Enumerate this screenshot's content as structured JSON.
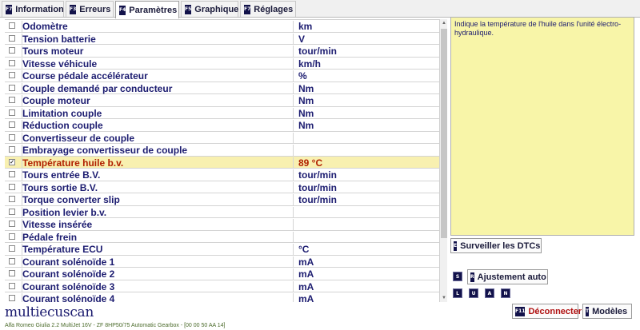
{
  "tabs": [
    {
      "key": "F7",
      "label": "Information"
    },
    {
      "key": "F3",
      "label": "Erreurs"
    },
    {
      "key": "F4",
      "label": "Paramètres"
    },
    {
      "key": "F5",
      "label": "Graphique"
    },
    {
      "key": "F7",
      "label": "Réglages"
    }
  ],
  "parameters": [
    {
      "name": "Odomètre",
      "value": "km",
      "checked": false
    },
    {
      "name": "Tension batterie",
      "value": "V",
      "checked": false
    },
    {
      "name": "Tours moteur",
      "value": "tour/min",
      "checked": false
    },
    {
      "name": "Vitesse véhicule",
      "value": "km/h",
      "checked": false
    },
    {
      "name": "Course pédale accélérateur",
      "value": "%",
      "checked": false
    },
    {
      "name": "Couple demandé par conducteur",
      "value": "Nm",
      "checked": false
    },
    {
      "name": "Couple moteur",
      "value": "Nm",
      "checked": false
    },
    {
      "name": "Limitation couple",
      "value": "Nm",
      "checked": false
    },
    {
      "name": "Réduction couple",
      "value": "Nm",
      "checked": false
    },
    {
      "name": "Convertisseur de couple",
      "value": "",
      "checked": false
    },
    {
      "name": "Embrayage convertisseur de couple",
      "value": "",
      "checked": false
    },
    {
      "name": "Température huile b.v.",
      "value": "89 °C",
      "checked": true
    },
    {
      "name": "Tours entrée B.V.",
      "value": "tour/min",
      "checked": false
    },
    {
      "name": "Tours sortie B.V.",
      "value": "tour/min",
      "checked": false
    },
    {
      "name": "Torque converter slip",
      "value": "tour/min",
      "checked": false
    },
    {
      "name": "Position levier b.v.",
      "value": "",
      "checked": false
    },
    {
      "name": "Vitesse insérée",
      "value": "",
      "checked": false
    },
    {
      "name": "Pédale frein",
      "value": "",
      "checked": false
    },
    {
      "name": "Température ECU",
      "value": "°C",
      "checked": false
    },
    {
      "name": "Courant solénoïde 1",
      "value": "mA",
      "checked": false
    },
    {
      "name": "Courant solénoïde 2",
      "value": "mA",
      "checked": false
    },
    {
      "name": "Courant solénoïde 3",
      "value": "mA",
      "checked": false
    },
    {
      "name": "Courant solénoïde 4",
      "value": "mA",
      "checked": false
    }
  ],
  "description": "Indique la température de l'huile dans l'unité électro-hydraulique.",
  "buttons": {
    "monitor_key": "E",
    "monitor_label": "Surveiller les DTCs",
    "s_key": "S",
    "auto_key": "R",
    "auto_label": "Ajustement auto",
    "l_key": "L",
    "u_key": "U",
    "a_key": "A",
    "n_key": "N",
    "disconnect_key": "F11",
    "disconnect_label": "Déconnecter",
    "models_key": "T",
    "models_label": "Modèles"
  },
  "logo_text": "multiecuscan",
  "status_text": "Alfa Romeo Giulia 2.2 MultiJet 16V - ZF 8HP50/75 Automatic Gearbox - [00 00 50 AA 14]",
  "selected_row_index": 11,
  "colors": {
    "selected_bg": "#f8f0b0",
    "selected_text": "#b02000",
    "description_bg": "#f8f5a8",
    "text": "#1c1c70"
  }
}
